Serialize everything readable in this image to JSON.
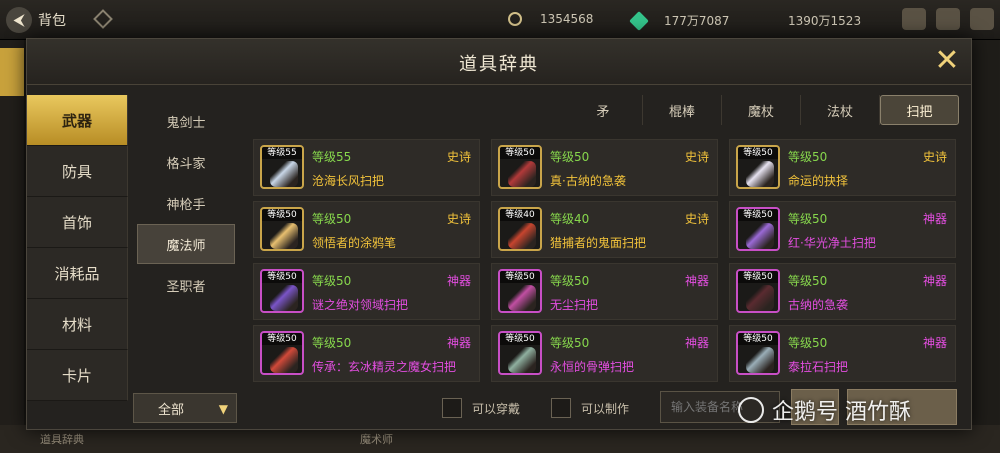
{
  "topbar": {
    "back_label": "背包",
    "currencies": [
      {
        "value": "1354568",
        "icon": "coin-icon",
        "color": "#d2c08a"
      },
      {
        "value": "177万7087",
        "icon": "gem-icon",
        "color": "#34c48b"
      },
      {
        "value": "1390万1523",
        "icon": "gold-icon",
        "color": "#e0a93a"
      }
    ]
  },
  "background": {
    "bottom_left_text": "道具辞典",
    "bottom_center_text": "魔术师"
  },
  "dialog": {
    "title": "道具辞典",
    "close_symbol": "✕",
    "categories": [
      "武器",
      "防具",
      "首饰",
      "消耗品",
      "材料",
      "卡片"
    ],
    "active_category": "武器",
    "classes": [
      "鬼剑士",
      "格斗家",
      "神枪手",
      "魔法师",
      "圣职者"
    ],
    "active_class": "魔法师",
    "weapon_types": [
      "矛",
      "棍棒",
      "魔杖",
      "法杖",
      "扫把"
    ],
    "active_weapon_type": "扫把",
    "items": [
      {
        "thumb_level": "等级55",
        "level": "等级55",
        "rarity": "史诗",
        "name": "沧海长风扫把",
        "tier": "epic"
      },
      {
        "thumb_level": "等级50",
        "level": "等级50",
        "rarity": "史诗",
        "name": "真·古纳的急袭",
        "tier": "epic"
      },
      {
        "thumb_level": "等级50",
        "level": "等级50",
        "rarity": "史诗",
        "name": "命运的抉择",
        "tier": "epic"
      },
      {
        "thumb_level": "等级50",
        "level": "等级50",
        "rarity": "史诗",
        "name": "领悟者的涂鸦笔",
        "tier": "epic"
      },
      {
        "thumb_level": "等级40",
        "level": "等级40",
        "rarity": "史诗",
        "name": "猎捕者的鬼面扫把",
        "tier": "epic"
      },
      {
        "thumb_level": "等级50",
        "level": "等级50",
        "rarity": "神器",
        "name": "红·华光净土扫把",
        "tier": "art"
      },
      {
        "thumb_level": "等级50",
        "level": "等级50",
        "rarity": "神器",
        "name": "谜之绝对领域扫把",
        "tier": "art"
      },
      {
        "thumb_level": "等级50",
        "level": "等级50",
        "rarity": "神器",
        "name": "无尘扫把",
        "tier": "art"
      },
      {
        "thumb_level": "等级50",
        "level": "等级50",
        "rarity": "神器",
        "name": "古纳的急袭",
        "tier": "art"
      },
      {
        "thumb_level": "等级50",
        "level": "等级50",
        "rarity": "神器",
        "name": "传承：玄冰精灵之魔女扫把",
        "tier": "art"
      },
      {
        "thumb_level": "等级50",
        "level": "等级50",
        "rarity": "神器",
        "name": "永恒的骨弹扫把",
        "tier": "art"
      },
      {
        "thumb_level": "等级50",
        "level": "等级50",
        "rarity": "神器",
        "name": "泰拉石扫把",
        "tier": "art"
      }
    ],
    "filter": {
      "selected": "全部",
      "arrow": "▼"
    },
    "checkbox_wearable": "可以穿戴",
    "checkbox_craftable": "可以制作",
    "search_placeholder": "输入装备名称"
  },
  "watermark": {
    "text": "企鹅号 酒竹酥"
  },
  "colors": {
    "gold": "#e9c85e",
    "epic": "#f2c33b",
    "artifact": "#e34ee0",
    "level": "#86d64c"
  }
}
